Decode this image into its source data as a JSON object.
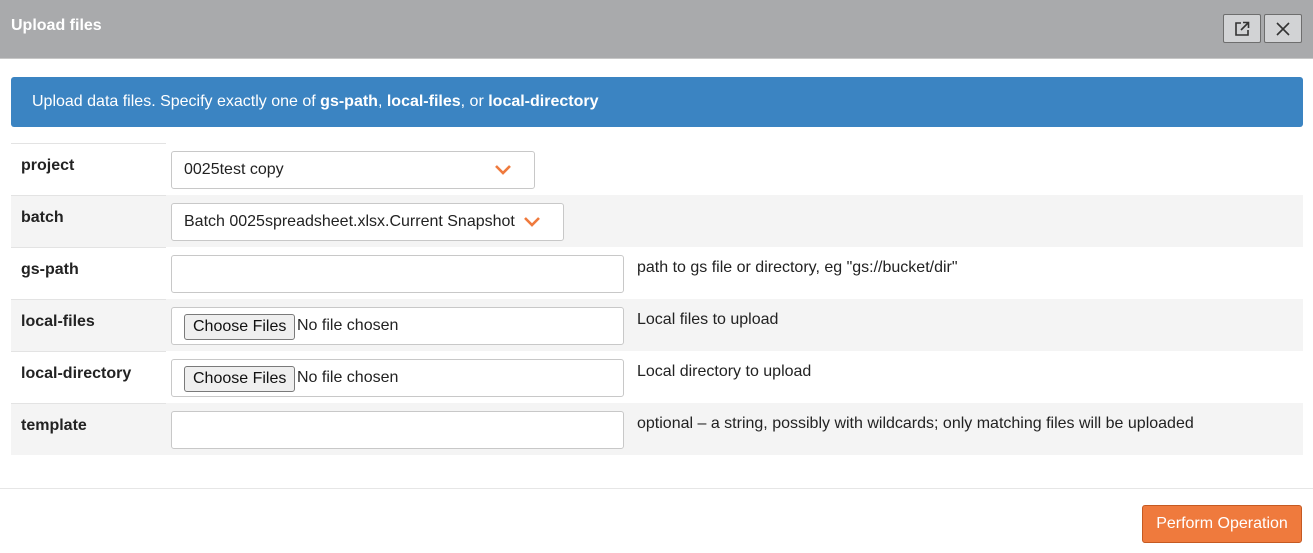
{
  "dialog": {
    "title": "Upload files",
    "popout_icon": "external-link-icon",
    "close_icon": "close-icon"
  },
  "banner": {
    "prefix": "Upload data files. Specify exactly one of ",
    "term1": "gs-path",
    "sep1": ", ",
    "term2": "local-files",
    "sep2": ", or ",
    "term3": "local-directory"
  },
  "form": {
    "project": {
      "label": "project",
      "value": "0025test copy"
    },
    "batch": {
      "label": "batch",
      "value": "Batch 0025spreadsheet.xlsx.Current Snapshot"
    },
    "gs_path": {
      "label": "gs-path",
      "value": "",
      "help": "path to gs file or directory, eg \"gs://bucket/dir\""
    },
    "local_files": {
      "label": "local-files",
      "button": "Choose Files",
      "status": "No file chosen",
      "help": "Local files to upload"
    },
    "local_directory": {
      "label": "local-directory",
      "button": "Choose Files",
      "status": "No file chosen",
      "help": "Local directory to upload"
    },
    "template": {
      "label": "template",
      "value": "",
      "help": "optional – a string, possibly with wildcards; only matching files will be uploaded"
    }
  },
  "colors": {
    "banner": "#3b84c2",
    "accent": "#ef7a3d",
    "titlebar": "#a9aaac"
  },
  "footer": {
    "perform_label": "Perform Operation"
  }
}
